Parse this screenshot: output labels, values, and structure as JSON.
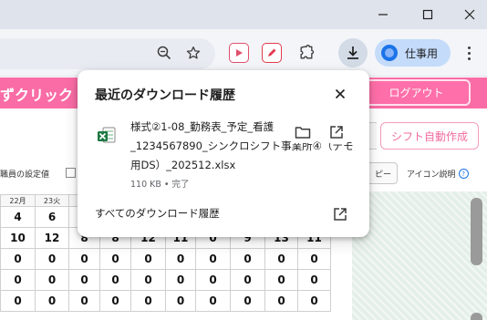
{
  "browser": {
    "profile_label": "仕事用",
    "icons": {
      "minimize": "minimize-icon",
      "maximize": "maximize-icon",
      "close": "close-icon",
      "zoom": "zoom-icon",
      "bookmark": "star-icon",
      "extensions": "puzzle-icon",
      "downloads": "download-icon",
      "menu": "more-vert-icon"
    }
  },
  "download_bubble": {
    "title": "最近のダウンロード履歴",
    "file_name_lines": [
      "様式②1-08_勤務表_予定_看護",
      "_1234567890_シンクロシフト事業所④（デモ",
      "用DS）_202512.xlsx"
    ],
    "file_meta": "110 KB • 完了",
    "all_history_label": "すべてのダウンロード履歴"
  },
  "page": {
    "brand_fragment": "ずクリック",
    "logout_label": "ログアウト",
    "shift_auto_label": "シフト自動作成",
    "staff_settings_label": "職員の設定値",
    "button_fragment": "ピー",
    "icon_help_label": "アイコン説明",
    "colors": {
      "pink": "#fa6ca6",
      "accent_blue": "#1a73e8"
    },
    "grid": {
      "headers": [
        "22月",
        "23火"
      ],
      "rows": [
        [
          "4",
          "6",
          "",
          "",
          "",
          "",
          "",
          "",
          "",
          ""
        ],
        [
          "10",
          "12",
          "8",
          "8",
          "12",
          "11",
          "0",
          "9",
          "13",
          "11"
        ],
        [
          "0",
          "0",
          "0",
          "0",
          "0",
          "0",
          "0",
          "0",
          "0",
          "0"
        ],
        [
          "0",
          "0",
          "0",
          "0",
          "0",
          "0",
          "0",
          "0",
          "0",
          "0"
        ],
        [
          "0",
          "0",
          "0",
          "0",
          "0",
          "0",
          "0",
          "0",
          "0",
          "0"
        ]
      ]
    }
  }
}
